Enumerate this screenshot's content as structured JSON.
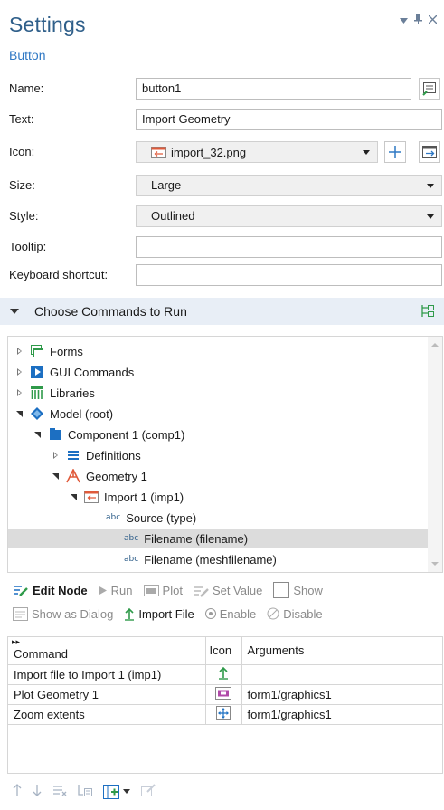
{
  "header": {
    "title": "Settings",
    "subtitle": "Button"
  },
  "form": {
    "name": {
      "label": "Name:",
      "value": "button1"
    },
    "text": {
      "label": "Text:",
      "value": "Import Geometry"
    },
    "icon": {
      "label": "Icon:",
      "value": "import_32.png"
    },
    "size": {
      "label": "Size:",
      "value": "Large"
    },
    "style": {
      "label": "Style:",
      "value": "Outlined"
    },
    "tooltip": {
      "label": "Tooltip:",
      "value": ""
    },
    "shortcut": {
      "label": "Keyboard shortcut:",
      "value": ""
    }
  },
  "section": {
    "title": "Choose Commands to Run"
  },
  "tree": {
    "items": [
      {
        "label": "Forms"
      },
      {
        "label": "GUI Commands"
      },
      {
        "label": "Libraries"
      },
      {
        "label": "Model (root)"
      },
      {
        "label": "Component 1 (comp1)"
      },
      {
        "label": "Definitions"
      },
      {
        "label": "Geometry 1"
      },
      {
        "label": "Import 1 (imp1)"
      },
      {
        "label": "Source (type)",
        "tag": "abc"
      },
      {
        "label": "Filename (filename)",
        "tag": "abc",
        "selected": true
      },
      {
        "label": "Filename (meshfilename)",
        "tag": "abc"
      }
    ]
  },
  "toolbar": {
    "edit_node": "Edit Node",
    "run": "Run",
    "plot": "Plot",
    "set_value": "Set Value",
    "show": "Show",
    "show_as_dialog": "Show as Dialog",
    "import_file": "Import File",
    "enable": "Enable",
    "disable": "Disable"
  },
  "table": {
    "headers": {
      "command": "Command",
      "icon": "Icon",
      "arguments": "Arguments"
    },
    "rows": [
      {
        "command": "Import file to Import 1 (imp1)",
        "icon": "import-arrow-icon",
        "arguments": ""
      },
      {
        "command": "Plot Geometry 1",
        "icon": "plot-icon",
        "arguments": "form1/graphics1"
      },
      {
        "command": "Zoom extents",
        "icon": "zoom-extents-icon",
        "arguments": "form1/graphics1"
      }
    ]
  },
  "colors": {
    "title": "#2f5f8a",
    "subtitle": "#2f78c4",
    "section_bg": "#e8eef6",
    "selected_row": "#dcdcdc",
    "accent_blue": "#2f78c4"
  }
}
